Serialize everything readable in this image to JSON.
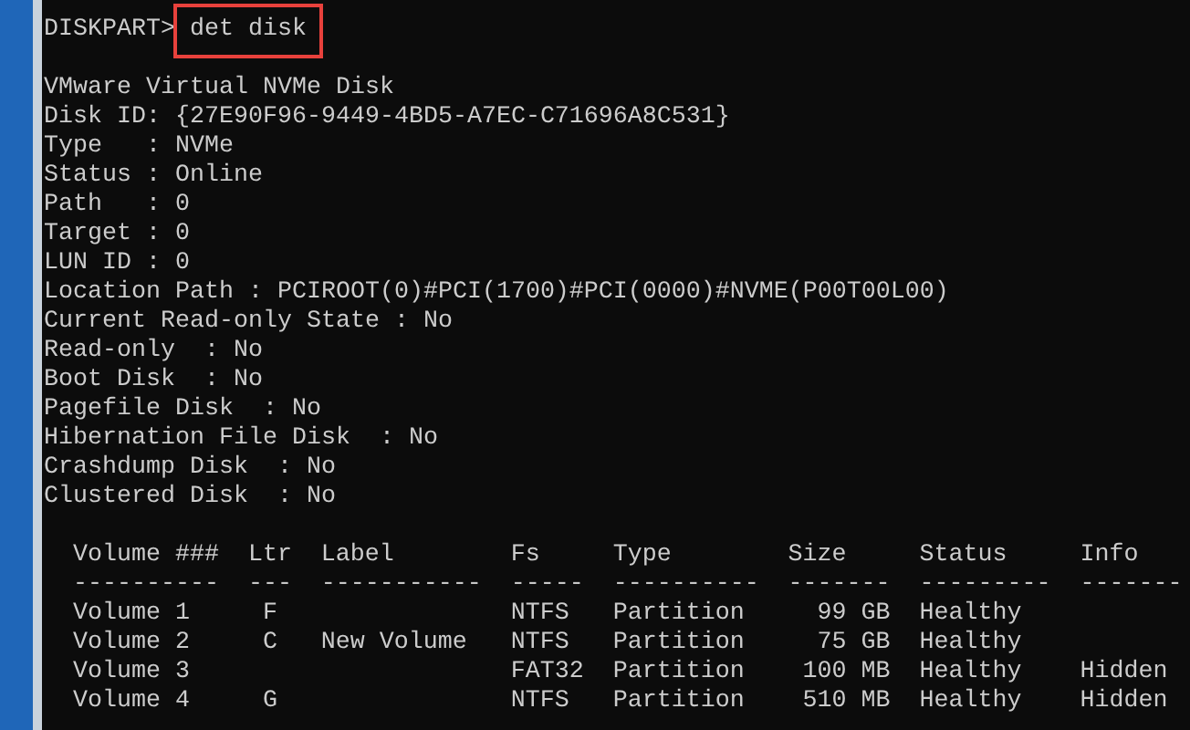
{
  "prompt": {
    "text": "DISKPART>",
    "command": "det disk",
    "highlighted": true
  },
  "details": [
    "VMware Virtual NVMe Disk",
    "Disk ID: {27E90F96-9449-4BD5-A7EC-C71696A8C531}",
    "Type   : NVMe",
    "Status : Online",
    "Path   : 0",
    "Target : 0",
    "LUN ID : 0",
    "Location Path : PCIROOT(0)#PCI(1700)#PCI(0000)#NVME(P00T00L00)",
    "Current Read-only State : No",
    "Read-only  : No",
    "Boot Disk  : No",
    "Pagefile Disk  : No",
    "Hibernation File Disk  : No",
    "Crashdump Disk  : No",
    "Clustered Disk  : No"
  ],
  "table": {
    "columns": [
      {
        "label": "Volume ###",
        "rule": "----------"
      },
      {
        "label": "Ltr",
        "rule": "---"
      },
      {
        "label": "Label",
        "rule": "-----------"
      },
      {
        "label": "Fs",
        "rule": "-----"
      },
      {
        "label": "Type",
        "rule": "----------"
      },
      {
        "label": "Size",
        "rule": "-------"
      },
      {
        "label": "Status",
        "rule": "---------"
      },
      {
        "label": "Info",
        "rule": "-------"
      }
    ],
    "rows": [
      [
        "Volume 1",
        "F",
        "",
        "NTFS",
        "Partition",
        "99 GB",
        "Healthy",
        ""
      ],
      [
        "Volume 2",
        "C",
        "New Volume",
        "NTFS",
        "Partition",
        "75 GB",
        "Healthy",
        ""
      ],
      [
        "Volume 3",
        "",
        "",
        "FAT32",
        "Partition",
        "100 MB",
        "Healthy",
        "Hidden"
      ],
      [
        "Volume 4",
        "G",
        "",
        "NTFS",
        "Partition",
        "510 MB",
        "Healthy",
        "Hidden"
      ]
    ]
  }
}
